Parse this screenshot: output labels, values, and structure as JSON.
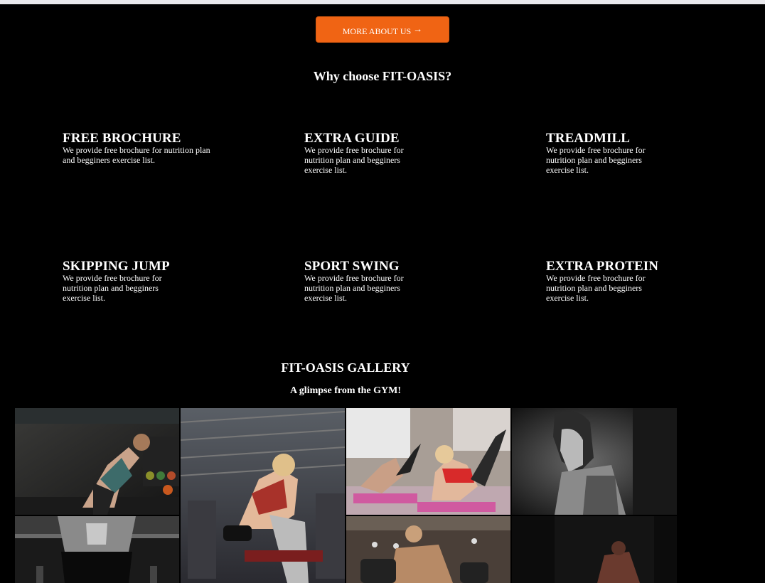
{
  "header": {
    "more_button_label": "MORE ABOUT US",
    "more_button_icon": "arrow-right-icon"
  },
  "why_section": {
    "title": "Why choose FIT-OASIS?"
  },
  "features": [
    {
      "title": "FREE BROCHURE",
      "desc_line1": "We provide free brochure for nutrition plan",
      "desc_line2": "and begginers exercise list.",
      "desc_line3": ""
    },
    {
      "title": "EXTRA GUIDE",
      "desc_line1": "We provide free brochure for",
      "desc_line2": "nutrition plan and begginers",
      "desc_line3": "exercise list."
    },
    {
      "title": "TREADMILL",
      "desc_line1": "We provide free brochure for",
      "desc_line2": "nutrition plan and begginers",
      "desc_line3": "exercise list."
    },
    {
      "title": "SKIPPING JUMP",
      "desc_line1": "We provide free brochure for",
      "desc_line2": "nutrition plan and begginers",
      "desc_line3": "exercise list."
    },
    {
      "title": "SPORT SWING",
      "desc_line1": "We provide free brochure for",
      "desc_line2": "nutrition plan and begginers",
      "desc_line3": "exercise list."
    },
    {
      "title": "EXTRA PROTEIN",
      "desc_line1": "We provide free brochure for",
      "desc_line2": "nutrition plan and begginers",
      "desc_line3": "exercise list."
    }
  ],
  "gallery": {
    "title": "FIT-OASIS GALLERY",
    "subtitle": "A glimpse from the GYM!"
  },
  "colors": {
    "accent": "#f06414",
    "background": "#000000",
    "text": "#ffffff"
  }
}
